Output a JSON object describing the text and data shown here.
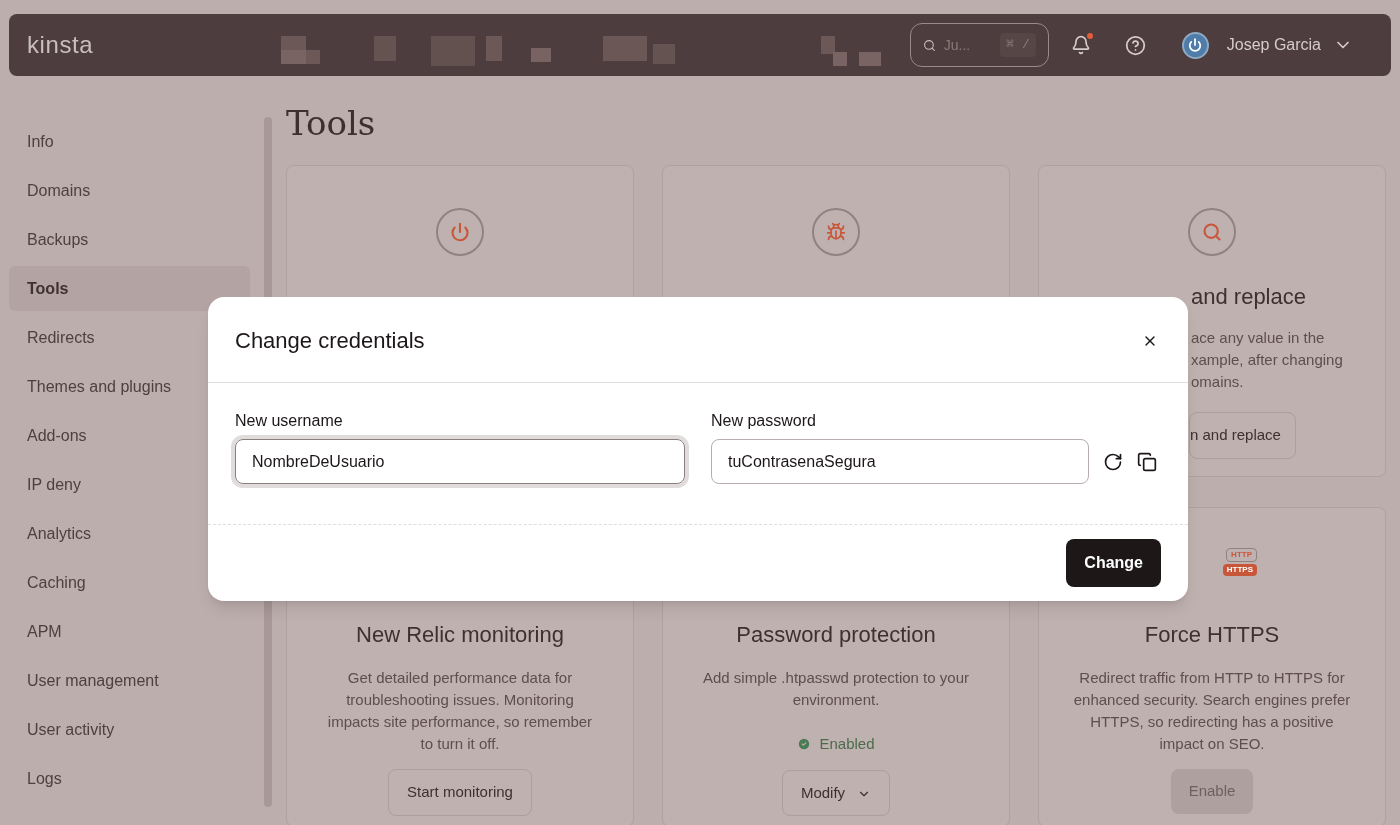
{
  "header": {
    "logo": "kinsta",
    "search": {
      "placeholder": "Ju...",
      "shortcut": "⌘ /"
    },
    "notifications": {
      "unread": true
    },
    "user": {
      "name": "Josep Garcia"
    }
  },
  "sidebar": {
    "items": [
      {
        "label": "Info",
        "selected": false
      },
      {
        "label": "Domains",
        "selected": false
      },
      {
        "label": "Backups",
        "selected": false
      },
      {
        "label": "Tools",
        "selected": true
      },
      {
        "label": "Redirects",
        "selected": false
      },
      {
        "label": "Themes and plugins",
        "selected": false
      },
      {
        "label": "Add-ons",
        "selected": false
      },
      {
        "label": "IP deny",
        "selected": false
      },
      {
        "label": "Analytics",
        "selected": false
      },
      {
        "label": "Caching",
        "selected": false
      },
      {
        "label": "APM",
        "selected": false
      },
      {
        "label": "User management",
        "selected": false
      },
      {
        "label": "User activity",
        "selected": false
      },
      {
        "label": "Logs",
        "selected": false
      }
    ]
  },
  "page": {
    "title": "Tools"
  },
  "cards_top": [
    {
      "kind": "power"
    },
    {
      "kind": "bug"
    },
    {
      "kind": "search",
      "title": "and replace",
      "description_lines": [
        "ace any value in the",
        "xample, after changing",
        "omains."
      ],
      "button": "n and replace"
    }
  ],
  "cards_bottom": [
    {
      "kind": "button",
      "title": "New Relic monitoring",
      "description": "Get detailed performance data for troubleshooting issues. Monitoring impacts site performance, so remember to turn it off.",
      "button": {
        "label": "Start monitoring",
        "disabled": false
      }
    },
    {
      "kind": "status",
      "title": "Password protection",
      "description": "Add simple .htpasswd protection to your environment.",
      "status": "Enabled",
      "button": {
        "label": "Modify",
        "disabled": false
      }
    },
    {
      "kind": "button",
      "title": "Force HTTPS",
      "description": "Redirect traffic from HTTP to HTTPS for enhanced security. Search engines prefer HTTPS, so redirecting has a positive impact on SEO.",
      "icon_labels": [
        "HTTP",
        "HTTPS"
      ],
      "button": {
        "label": "Enable",
        "disabled": true
      }
    }
  ],
  "modal": {
    "title": "Change credentials",
    "fields": [
      {
        "label": "New username",
        "value": "NombreDeUsuario",
        "focused": true
      },
      {
        "label": "New password",
        "value": "tuContrasenaSegura",
        "focused": false
      }
    ],
    "submit": "Change"
  }
}
